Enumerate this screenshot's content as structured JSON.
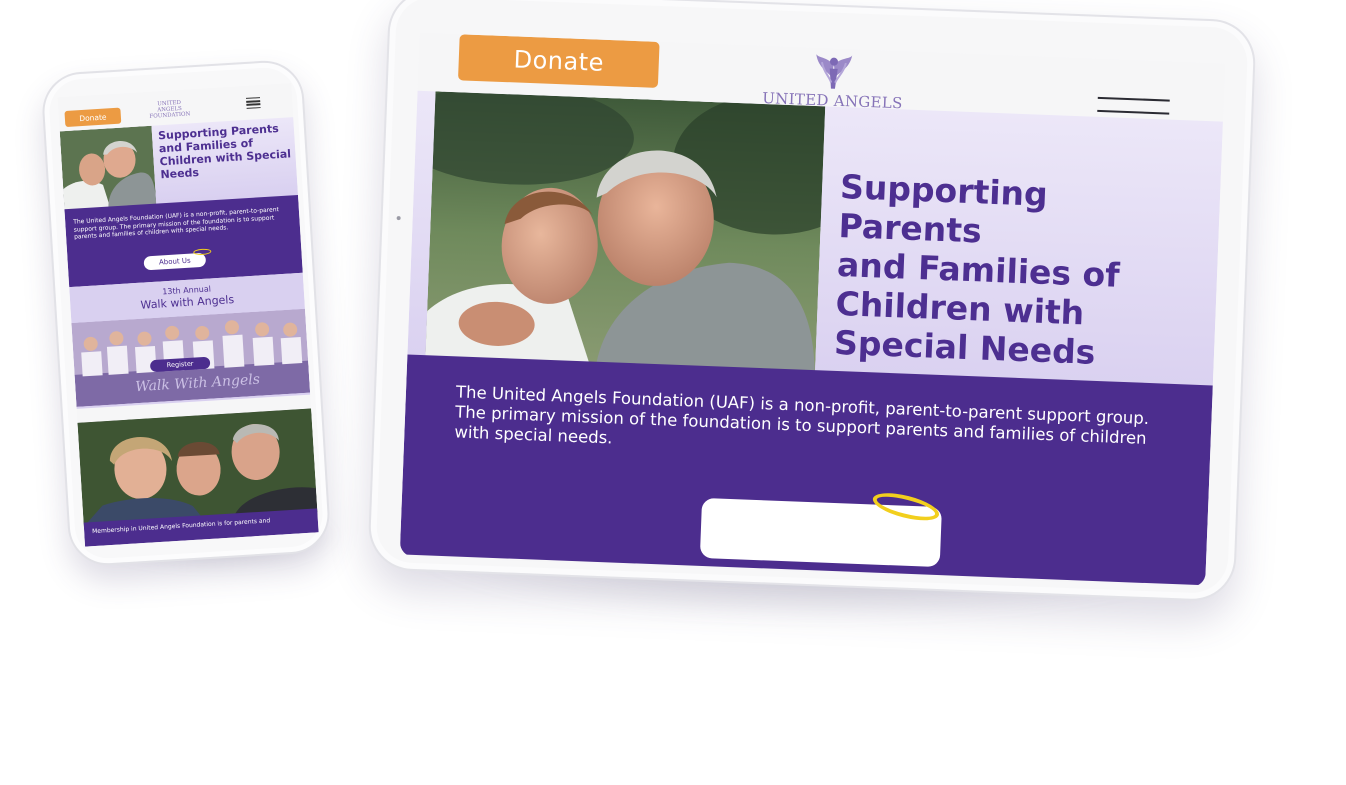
{
  "colors": {
    "brand_purple": "#4c2d8e",
    "headline_purple": "#4d2f91",
    "lavender": "#d9d0f0",
    "donate_orange": "#ec9b43",
    "halo_yellow": "#f2cf1d",
    "logo_purple": "#8673b8"
  },
  "site": {
    "donate_label": "Donate",
    "logo_line1": "UNITED ANGELS",
    "logo_line2": "FOUNDATION",
    "menu_icon": "hamburger-menu-icon"
  },
  "hero": {
    "headline_tablet": [
      "Supporting",
      "Parents",
      "and Families of",
      "Children with",
      "Special Needs"
    ],
    "headline_phone": "Supporting Parents and Families of Children with Special Needs"
  },
  "about": {
    "body_tablet": "The United Angels Foundation (UAF) is a non-profit, parent-to-parent support group. The primary mission of the foundation is to support parents and families of children with special needs.",
    "body_phone": "The United Angels Foundation (UAF) is a non-profit, parent-to-parent support group. The primary mission of the foundation is to support parents and families of children with special needs.",
    "button_label": "About Us"
  },
  "walk": {
    "kicker": "13th Annual",
    "title": "Walk with Angels",
    "register_label": "Register",
    "banner_text": "Walk With Angels"
  },
  "membership": {
    "text": "Membership in United Angels Foundation is for parents and"
  }
}
